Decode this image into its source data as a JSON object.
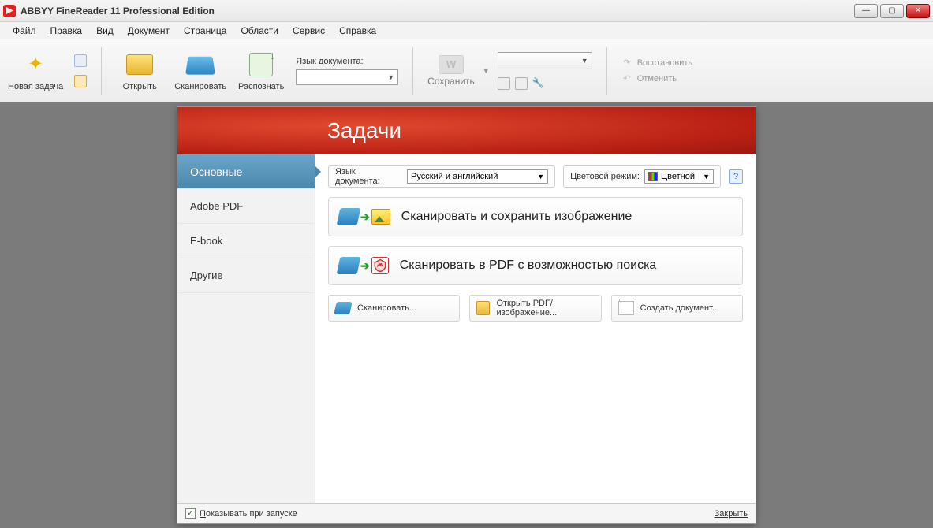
{
  "titlebar": {
    "title": "ABBYY FineReader 11 Professional Edition"
  },
  "menu": {
    "items": [
      {
        "u": "Ф",
        "rest": "айл"
      },
      {
        "u": "П",
        "rest": "равка"
      },
      {
        "u": "В",
        "rest": "ид"
      },
      {
        "u": "Д",
        "rest": "окумент"
      },
      {
        "u": "С",
        "rest": "траница"
      },
      {
        "u": "О",
        "rest": "бласти"
      },
      {
        "u": "С",
        "rest": "ервис"
      },
      {
        "u": "С",
        "rest": "правка"
      }
    ]
  },
  "toolbar": {
    "new_task": "Новая задача",
    "open": "Открыть",
    "scan": "Сканировать",
    "recognize": "Распознать",
    "lang_label": "Язык документа:",
    "save": "Сохранить",
    "save_glyph": "W",
    "restore": "Восстановить",
    "undo": "Отменить"
  },
  "tasks": {
    "heading": "Задачи",
    "side": [
      "Основные",
      "Adobe PDF",
      "E-book",
      "Другие"
    ],
    "lang_label": "Язык документа:",
    "lang_value": "Русский и английский",
    "color_label": "Цветовой режим:",
    "color_value": "Цветной",
    "help": "?",
    "big": [
      "Сканировать и сохранить изображение",
      "Сканировать в PDF с возможностью поиска"
    ],
    "small": [
      "Сканировать...",
      "Открыть PDF/изображение...",
      "Создать документ..."
    ],
    "show_on_start": "Показывать при запуске",
    "close": "Закрыть"
  }
}
